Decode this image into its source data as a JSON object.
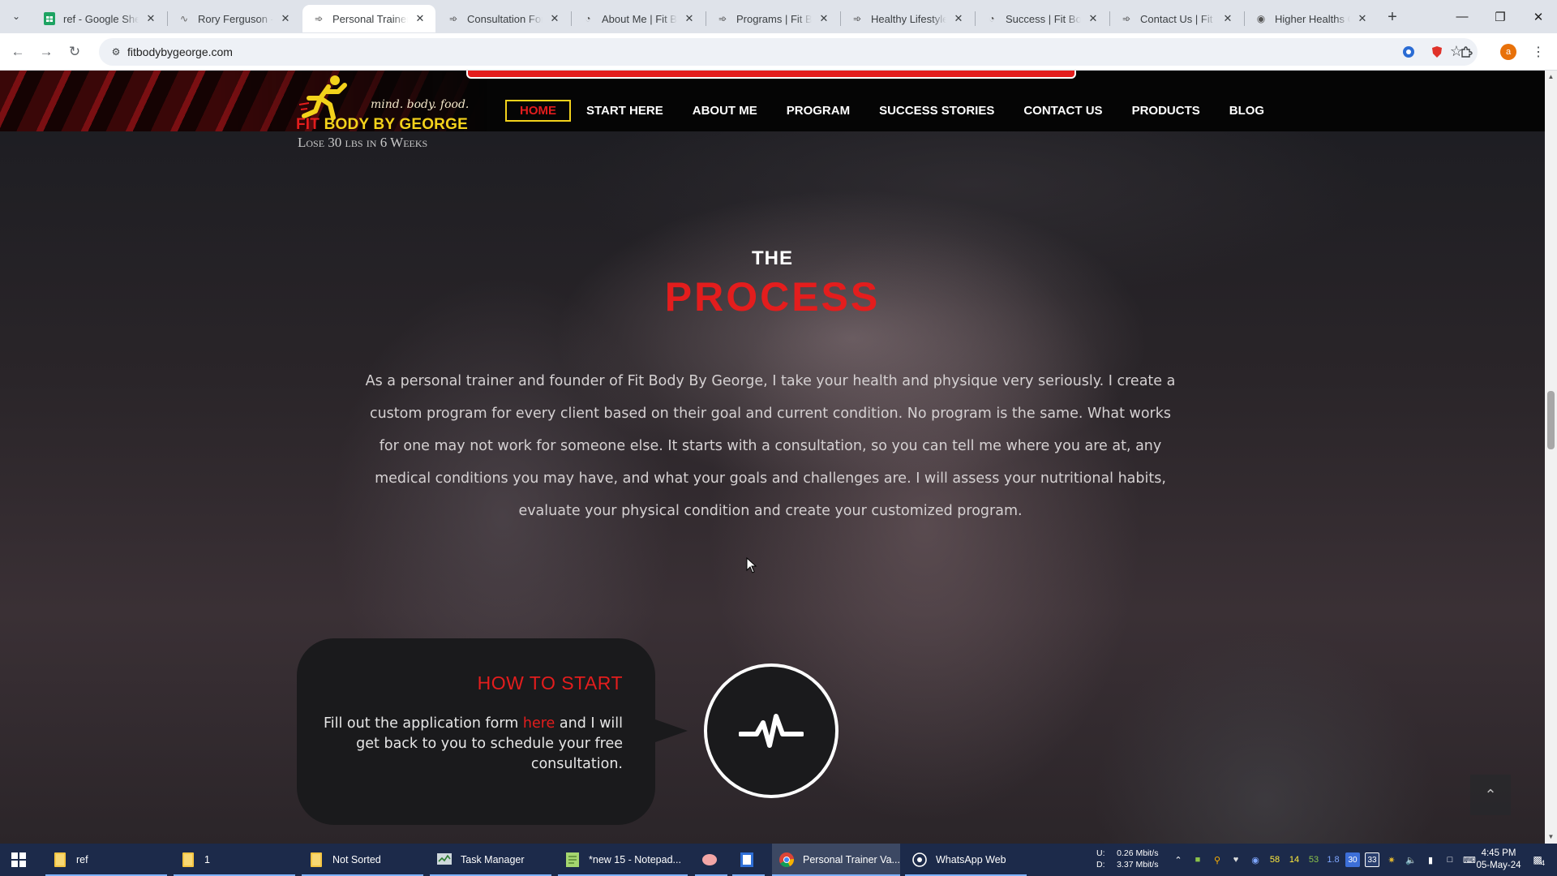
{
  "browser": {
    "tabs": [
      {
        "title": "ref - Google Sheets",
        "icon": "google-sheets-icon",
        "active": false
      },
      {
        "title": "Rory Ferguson - P",
        "icon": "signature-icon",
        "active": false
      },
      {
        "title": "Personal Trainer V",
        "icon": "runner-icon",
        "active": true
      },
      {
        "title": "Consultation Form",
        "icon": "runner-icon",
        "active": false
      },
      {
        "title": "About Me | Fit Bo",
        "icon": "loading-icon",
        "active": false
      },
      {
        "title": "Programs | Fit Boc",
        "icon": "runner-icon",
        "active": false
      },
      {
        "title": "Healthy Lifestyle",
        "icon": "runner-icon",
        "active": false
      },
      {
        "title": "Success | Fit Body",
        "icon": "loading-icon",
        "active": false
      },
      {
        "title": "Contact Us | Fit Bo",
        "icon": "runner-icon",
        "active": false
      },
      {
        "title": "Higher Healths Ca",
        "icon": "globe-icon",
        "active": false
      }
    ],
    "url": "fitbodybygeorge.com",
    "profile_initial": "a"
  },
  "site": {
    "logo": {
      "tagline": "mind. body. food.",
      "brand_part1": "FIT ",
      "brand_part2": "BODY BY GEORGE",
      "subtitle": "Lose 30 lbs in 6 Weeks"
    },
    "nav": [
      "HOME",
      "START HERE",
      "ABOUT ME",
      "PROGRAM",
      "SUCCESS STORIES",
      "CONTACT US",
      "PRODUCTS",
      "BLOG"
    ],
    "nav_active": "HOME",
    "process": {
      "kicker": "THE",
      "heading": "PROCESS",
      "body": "As a personal trainer and founder of Fit Body By George, I take your health and physique very seriously. I create a custom program for every client based on their goal and current condition. No program is the same. What works for one may not work for someone else. It starts with a consultation, so you can tell me where you are at, any medical conditions you may have, and what your goals and challenges are. I will assess your nutritional habits, evaluate your physical condition and create your customized program."
    },
    "how_to_start": {
      "title": "HOW TO START",
      "text_before": "Fill out the application form ",
      "link": "here",
      "text_after": " and I will get back to you to schedule your free consultation."
    },
    "colors": {
      "accent_red": "#e31d1d",
      "accent_yellow": "#f3d21b",
      "background": "#1a1a1d"
    }
  },
  "taskbar": {
    "items": [
      {
        "label": "ref",
        "icon": "folder-icon"
      },
      {
        "label": "1",
        "icon": "folder-icon"
      },
      {
        "label": "Not Sorted",
        "icon": "folder-icon"
      },
      {
        "label": "Task Manager",
        "icon": "task-manager-icon"
      },
      {
        "label": "*new 15 - Notepad...",
        "icon": "notepad-plus-icon"
      },
      {
        "label": "",
        "icon": "app-icon"
      },
      {
        "label": "",
        "icon": "document-icon"
      },
      {
        "label": "Personal Trainer Va...",
        "icon": "chrome-icon"
      },
      {
        "label": "WhatsApp Web",
        "icon": "whatsapp-icon"
      }
    ],
    "net_up": "0.26 Mbit/s",
    "net_down": "3.37 Mbit/s",
    "net_up_label": "U:",
    "net_down_label": "D:",
    "tray_numbers": [
      "58",
      "14",
      "53",
      "1.8",
      "30",
      "33"
    ],
    "time": "4:45 PM",
    "date": "05-May-24",
    "notifications": "4"
  }
}
